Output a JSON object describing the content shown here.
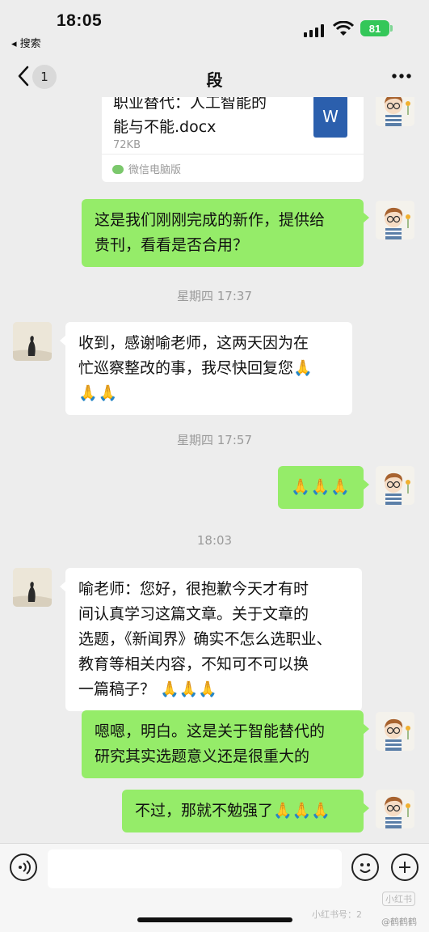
{
  "status_bar": {
    "time": "18:05",
    "back_label": "◂ 搜索",
    "battery": "81"
  },
  "nav": {
    "unread": "1",
    "title": "段"
  },
  "file": {
    "name_line1": "职业替代：人工智能的",
    "name_line2": "能与不能.docx",
    "size": "72KB",
    "source": "微信电脑版",
    "icon_letter": "W"
  },
  "messages": {
    "m1": [
      "这是我们刚刚完成的新作，提供给",
      "贵刊，看看是否合用？"
    ],
    "t1": "星期四 17:37",
    "m2": [
      "收到，感谢喻老师，这两天因为在",
      "忙巡察整改的事，我尽快回复您🙏",
      "🙏🙏"
    ],
    "t2": "星期四 17:57",
    "m3": "🙏🙏🙏",
    "t3": "18:03",
    "m4": [
      "喻老师：您好，很抱歉今天才有时",
      "间认真学习这篇文章。关于文章的",
      "选题，《新闻界》确实不怎么选职业、",
      "教育等相关内容，不知可不可以换",
      "一篇稿子？ 🙏🙏🙏"
    ],
    "m5": [
      "嗯嗯，明白。这是关于智能替代的",
      "研究其实选题意义还是很重大的"
    ],
    "m6": "不过，那就不勉强了🙏🙏🙏"
  },
  "watermark": {
    "line1": "小红书",
    "line2": "小红书号：2",
    "user": "@鹤鹤鹤"
  },
  "colors": {
    "bubble_me": "#95ec69",
    "bubble_other": "#ffffff",
    "background": "#ededed",
    "battery": "#34c759"
  }
}
